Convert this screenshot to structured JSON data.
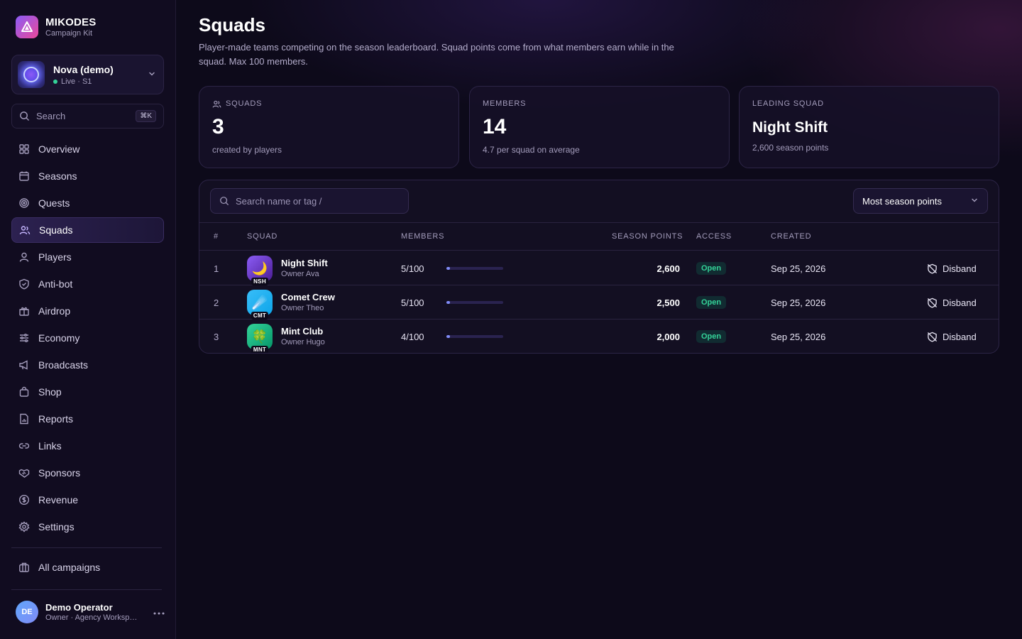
{
  "brand": {
    "name": "MIKODES",
    "sub": "Campaign Kit"
  },
  "campaign": {
    "name": "Nova (demo)",
    "status": "Live · S1"
  },
  "sidebar_search": {
    "label": "Search",
    "shortcut": "⌘K"
  },
  "nav": {
    "items": [
      {
        "label": "Overview",
        "icon": "grid-icon"
      },
      {
        "label": "Seasons",
        "icon": "calendar-icon"
      },
      {
        "label": "Quests",
        "icon": "target-icon"
      },
      {
        "label": "Squads",
        "icon": "users-icon",
        "active": true
      },
      {
        "label": "Players",
        "icon": "user-icon"
      },
      {
        "label": "Anti-bot",
        "icon": "shield-icon"
      },
      {
        "label": "Airdrop",
        "icon": "gift-icon"
      },
      {
        "label": "Economy",
        "icon": "sliders-icon"
      },
      {
        "label": "Broadcasts",
        "icon": "megaphone-icon"
      },
      {
        "label": "Shop",
        "icon": "shopping-bag-icon"
      },
      {
        "label": "Reports",
        "icon": "report-icon"
      },
      {
        "label": "Links",
        "icon": "link-icon"
      },
      {
        "label": "Sponsors",
        "icon": "handshake-icon"
      },
      {
        "label": "Revenue",
        "icon": "dollar-icon"
      },
      {
        "label": "Settings",
        "icon": "gear-icon"
      }
    ],
    "all_campaigns": "All campaigns"
  },
  "user": {
    "initials": "DE",
    "name": "Demo Operator",
    "role": "Owner · Agency Workspace"
  },
  "page": {
    "title": "Squads",
    "description": "Player-made teams competing on the season leaderboard. Squad points come from what members earn while in the squad. Max 100 members."
  },
  "stats": {
    "squads": {
      "label": "SQUADS",
      "value": "3",
      "sub": "created by players"
    },
    "members": {
      "label": "MEMBERS",
      "value": "14",
      "sub": "4.7 per squad on average"
    },
    "leading": {
      "label": "LEADING SQUAD",
      "value": "Night Shift",
      "sub": "2,600 season points"
    }
  },
  "table": {
    "search_placeholder": "Search name or tag  /",
    "sort_label": "Most season points",
    "columns": {
      "rank": "#",
      "squad": "SQUAD",
      "members": "MEMBERS",
      "points": "SEASON POINTS",
      "access": "ACCESS",
      "created": "CREATED"
    },
    "rows": [
      {
        "rank": "1",
        "name": "Night Shift",
        "owner": "Owner Ava",
        "tag": "NSH",
        "emoji": "🌙",
        "color_from": "#8b5cf6",
        "color_to": "#4c1d95",
        "members": "5/100",
        "fill": 0.05,
        "points": "2,600",
        "access": "Open",
        "created": "Sep 25, 2026",
        "action": "Disband"
      },
      {
        "rank": "2",
        "name": "Comet Crew",
        "owner": "Owner Theo",
        "tag": "CMT",
        "emoji": "☄️",
        "color_from": "#38bdf8",
        "color_to": "#0ea5e9",
        "members": "5/100",
        "fill": 0.05,
        "points": "2,500",
        "access": "Open",
        "created": "Sep 25, 2026",
        "action": "Disband"
      },
      {
        "rank": "3",
        "name": "Mint Club",
        "owner": "Owner Hugo",
        "tag": "MNT",
        "emoji": "🍀",
        "color_from": "#34d399",
        "color_to": "#059669",
        "members": "4/100",
        "fill": 0.04,
        "points": "2,000",
        "access": "Open",
        "created": "Sep 25, 2026",
        "action": "Disband"
      }
    ]
  }
}
